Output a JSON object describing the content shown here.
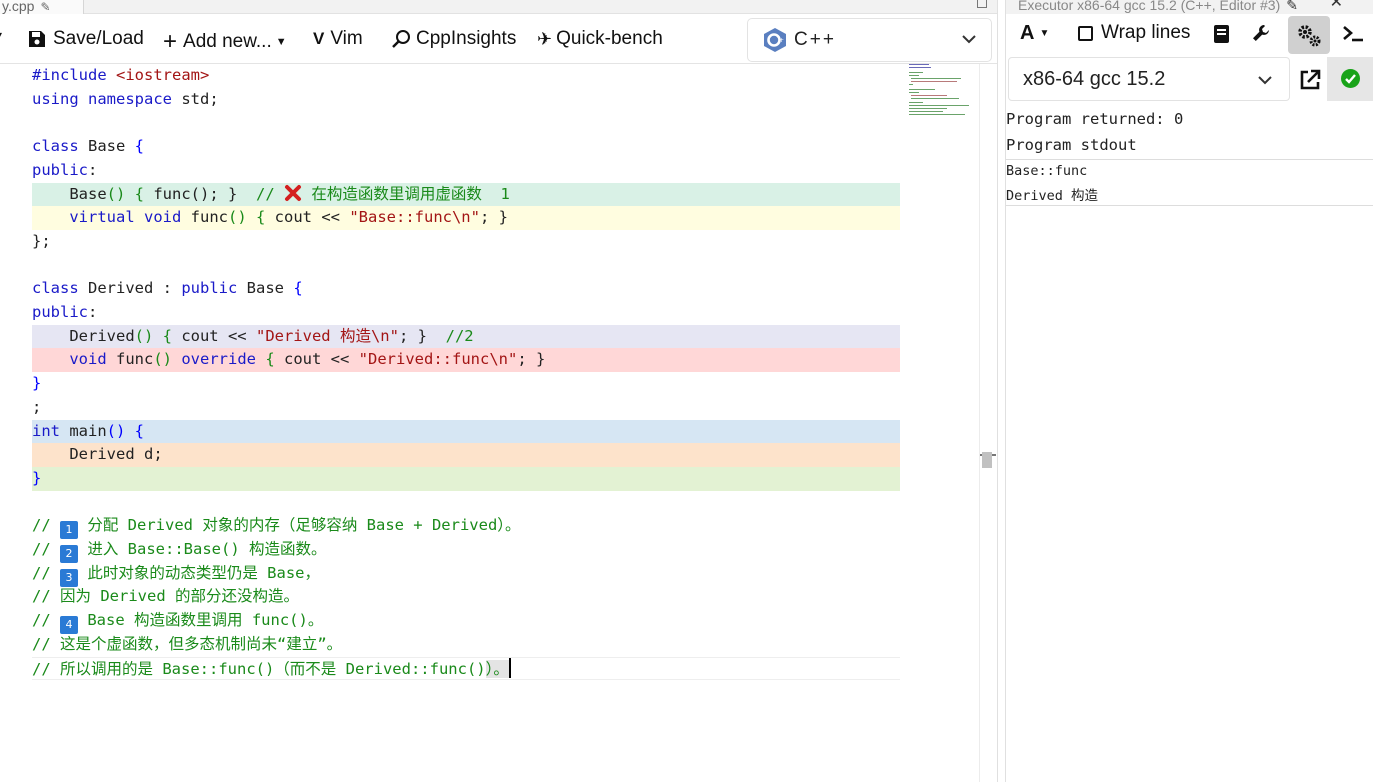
{
  "left_tab": {
    "title": "y.cpp"
  },
  "toolbar": {
    "save_load": "Save/Load",
    "add_new": "Add new...",
    "vim": "Vim",
    "cppinsights": "CppInsights",
    "quick_bench": "Quick-bench",
    "language": "C++"
  },
  "code": {
    "l1a": "#include ",
    "l1b": "<iostream>",
    "l2a": "using",
    "l2b": "namespace",
    "l2c": " std;",
    "l4a": "class",
    "l4b": " Base ",
    "l4c": "{",
    "l5a": "public",
    "l5b": ":",
    "l6a": "    Base",
    "l6b": "() { ",
    "l6c": "func",
    "l6d": "(); }",
    "l6e": "  // ",
    "l6f": " 在构造函数里调用虚函数  1",
    "l7a": "    virtual",
    "l7b": " void",
    "l7c": " func",
    "l7d": "() {",
    "l7e": " cout << ",
    "l7f": "\"Base::func\\n\"",
    "l7g": "; }",
    "l8": "};",
    "l10a": "class",
    "l10b": " Derived : ",
    "l10c": "public",
    "l10d": " Base ",
    "l10e": "{",
    "l11a": "public",
    "l11b": ":",
    "l12a": "    Derived",
    "l12b": "() {",
    "l12c": " cout << ",
    "l12d": "\"Derived 构造\\n\"",
    "l12e": "; }",
    "l12f": "  //2",
    "l13a": "    void",
    "l13b": " func",
    "l13c": "()",
    "l13d": " override",
    "l13e": " {",
    "l13f": " cout << ",
    "l13g": "\"Derived::func\\n\"",
    "l13h": "; }",
    "l14": "}",
    "l15": ";",
    "l16a": "int",
    "l16b": " main",
    "l16c": "() {",
    "l17": "    Derived d;",
    "l18": "}",
    "c1a": "// ",
    "c1b": "1",
    "c1c": " 分配 Derived 对象的内存（足够容纳 Base + Derived）。",
    "c2a": "// ",
    "c2b": "2",
    "c2c": " 进入 Base::Base() 构造函数。",
    "c3a": "// ",
    "c3b": "3",
    "c3c": " 此时对象的动态类型仍是 Base，",
    "c4": "// 因为 Derived 的部分还没构造。",
    "c5a": "// ",
    "c5b": "4",
    "c5c": " Base 构造函数里调用 func()。",
    "c6": "// 这是个虚函数，但多态机制尚未“建立”。",
    "c7a": "// 所以调用的是 Base::func()（而不是 Derived::func()",
    "c7b": "）。"
  },
  "executor": {
    "title": "Executor x86-64 gcc 15.2 (C++, Editor #3)",
    "wrap_lines": "Wrap lines",
    "compiler": "x86-64 gcc 15.2",
    "returned": "Program returned: 0",
    "stdout_label": "Program stdout",
    "stdout_lines": [
      "Base::func",
      "Derived 构造"
    ]
  },
  "colors": {
    "keyword": "#1a1ac8",
    "string": "#a31515",
    "comment": "#1a8a1a",
    "status_ok": "#19a319"
  }
}
